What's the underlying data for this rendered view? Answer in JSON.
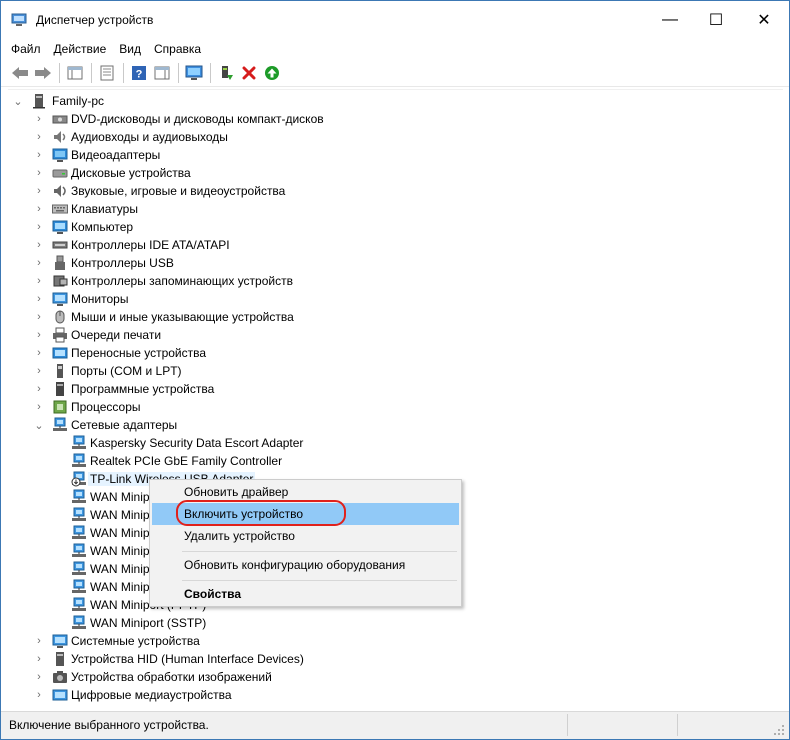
{
  "window": {
    "title": "Диспетчер устройств"
  },
  "window_controls": {
    "minimize": "—",
    "maximize": "☐",
    "close": "✕"
  },
  "menu": [
    "Файл",
    "Действие",
    "Вид",
    "Справка"
  ],
  "tree": {
    "root": "Family-pc",
    "categories": [
      "DVD-дисководы и дисководы компакт-дисков",
      "Аудиовходы и аудиовыходы",
      "Видеоадаптеры",
      "Дисковые устройства",
      "Звуковые, игровые и видеоустройства",
      "Клавиатуры",
      "Компьютер",
      "Контроллеры IDE ATA/ATAPI",
      "Контроллеры USB",
      "Контроллеры запоминающих устройств",
      "Мониторы",
      "Мыши и иные указывающие устройства",
      "Очереди печати",
      "Переносные устройства",
      "Порты (COM и LPT)",
      "Программные устройства",
      "Процессоры",
      "Сетевые адаптеры"
    ],
    "network_adapters": [
      "Kaspersky Security Data Escort Adapter",
      "Realtek PCIe GbE Family Controller",
      "TP-Link Wireless USB Adapter",
      "WAN Minip",
      "WAN Minip",
      "WAN Minip",
      "WAN Minip",
      "WAN Minip",
      "WAN Minip",
      "WAN Miniport (PPTP)",
      "WAN Miniport (SSTP)"
    ],
    "after_categories": [
      "Системные устройства",
      "Устройства HID (Human Interface Devices)",
      "Устройства обработки изображений",
      "Цифровые медиаустройства"
    ]
  },
  "context_menu": {
    "update_driver": "Обновить драйвер",
    "enable_device": "Включить устройство",
    "uninstall_device": "Удалить устройство",
    "scan_hardware": "Обновить конфигурацию оборудования",
    "properties": "Свойства"
  },
  "status": {
    "text": "Включение выбранного устройства."
  },
  "toolbar": {
    "icons": [
      "back-icon",
      "forward-icon",
      "console-tree-icon",
      "properties-icon",
      "help-icon",
      "action-pane-icon",
      "monitor-icon",
      "update-driver-icon",
      "disable-device-icon",
      "enable-device-icon"
    ]
  },
  "colors": {
    "selection": "#e5f3ff",
    "menu_highlight": "#91c9f7",
    "annotation_ring": "#e0211c",
    "enable_icon": "#1d9b28",
    "disable_icon": "#d61c1c"
  }
}
